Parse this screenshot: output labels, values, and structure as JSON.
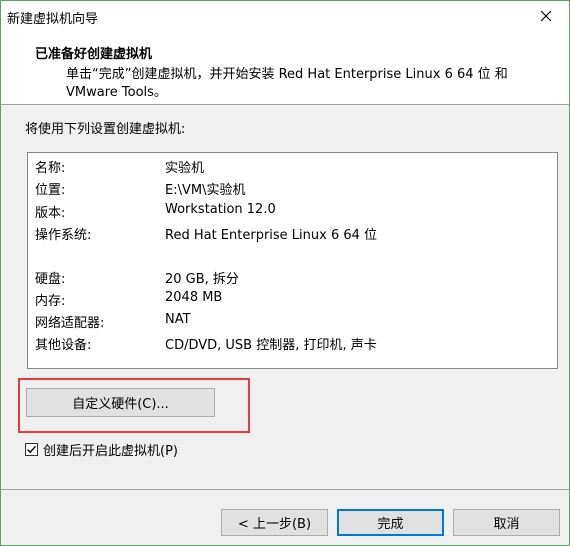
{
  "window": {
    "title": "新建虚拟机向导"
  },
  "header": {
    "title": "已准备好创建虚拟机",
    "description": "单击“完成”创建虚拟机，并开始安装 Red Hat Enterprise Linux 6 64 位 和 VMware Tools。"
  },
  "body": {
    "label": "将使用下列设置创建虚拟机:"
  },
  "summary": {
    "rows": [
      {
        "key": "名称:",
        "value": "实验机"
      },
      {
        "key": "位置:",
        "value": "E:\\VM\\实验机"
      },
      {
        "key": "版本:",
        "value": "Workstation 12.0"
      },
      {
        "key": "操作系统:",
        "value": "Red Hat Enterprise Linux 6 64 位"
      },
      {
        "key": "硬盘:",
        "value": "20 GB, 拆分"
      },
      {
        "key": "内存:",
        "value": "2048 MB"
      },
      {
        "key": "网络适配器:",
        "value": "NAT"
      },
      {
        "key": "其他设备:",
        "value": "CD/DVD, USB 控制器, 打印机, 声卡"
      }
    ]
  },
  "customize_button": {
    "label": "自定义硬件(C)..."
  },
  "power_on_checkbox": {
    "label": "创建后开启此虚拟机(P)",
    "checked": true
  },
  "buttons": {
    "back": "< 上一步(B)",
    "finish": "完成",
    "cancel": "取消"
  },
  "colors": {
    "highlight": "#e8393b",
    "window_border": "#59a65f",
    "default_button_border": "#0078d7"
  }
}
